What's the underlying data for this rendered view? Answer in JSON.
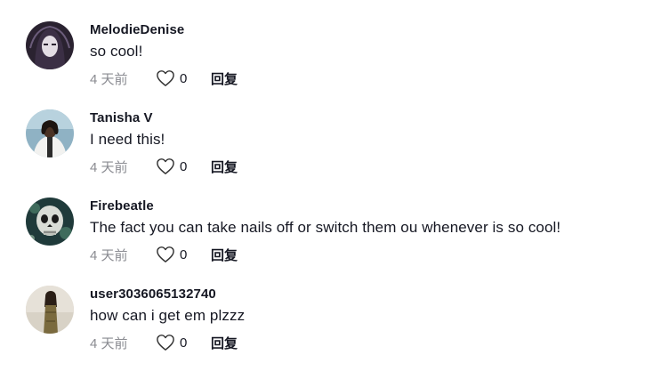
{
  "comments": [
    {
      "avatar": "avatar-melodiedenise",
      "username": "MelodieDenise",
      "text": "so cool!",
      "time": "4 天前",
      "likes": "0",
      "reply_label": "回复"
    },
    {
      "avatar": "avatar-tanisha-v",
      "username": "Tanisha V",
      "text": "I need this!",
      "time": "4 天前",
      "likes": "0",
      "reply_label": "回复"
    },
    {
      "avatar": "avatar-firebeatle",
      "username": "Firebeatle",
      "text": "The fact you can take nails off or switch them ou whenever is so cool!",
      "time": "4 天前",
      "likes": "0",
      "reply_label": "回复"
    },
    {
      "avatar": "avatar-user3036065132740",
      "username": "user3036065132740",
      "text": "how can i get em plzzz",
      "time": "4 天前",
      "likes": "0",
      "reply_label": "回复"
    }
  ],
  "icons": {
    "like": "heart-outline-icon"
  },
  "colors": {
    "text": "#161823",
    "muted": "#8a8b91"
  }
}
